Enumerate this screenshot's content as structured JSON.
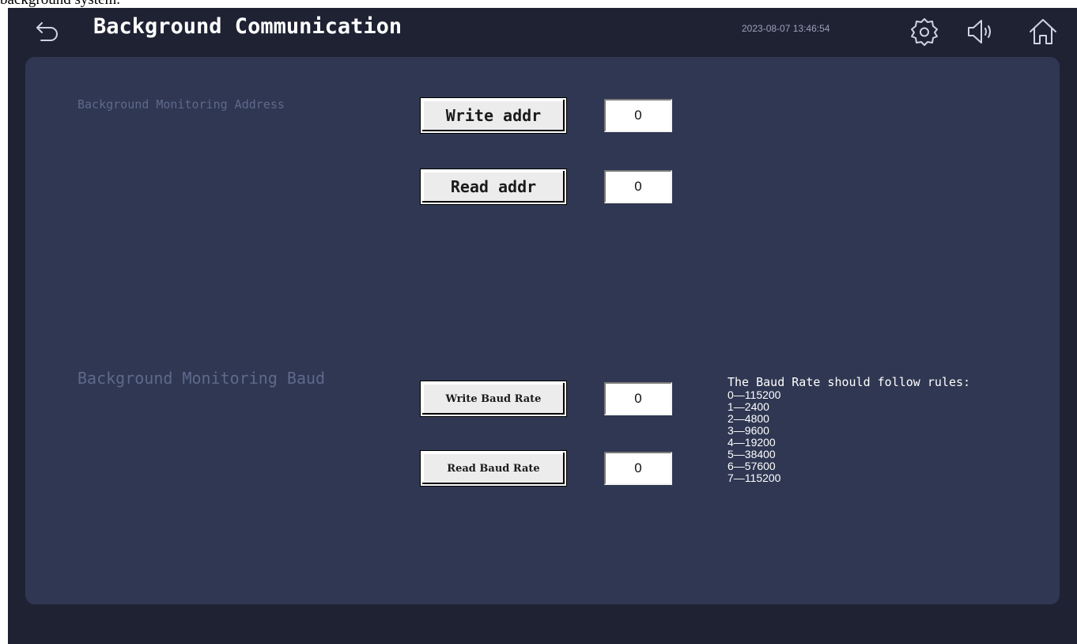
{
  "caption": "background system.",
  "header": {
    "title": "Background Communication",
    "datetime": "2023-08-07 13:46:54",
    "icons": [
      "back-arrow-icon",
      "gear-icon",
      "speaker-icon",
      "home-icon"
    ]
  },
  "address_section": {
    "label": "Background Monitoring Address",
    "write_button": "Write addr",
    "write_value": "0",
    "read_button": "Read addr",
    "read_value": "0"
  },
  "baud_section": {
    "label": "Background Monitoring Baud",
    "write_button": "Write Baud Rate",
    "write_value": "0",
    "read_button": "Read Baud Rate",
    "read_value": "0"
  },
  "baud_rules": {
    "title": "The Baud Rate should follow rules:",
    "items": [
      "0—115200",
      "1—2400",
      "2—4800",
      "3—9600",
      "4—19200",
      "5—38400",
      "6—57600",
      "7—115200"
    ]
  },
  "colors": {
    "background": "#1f2233",
    "panel": "#2f3752",
    "muted_label": "#5e6a8b",
    "text": "#ffffff"
  }
}
